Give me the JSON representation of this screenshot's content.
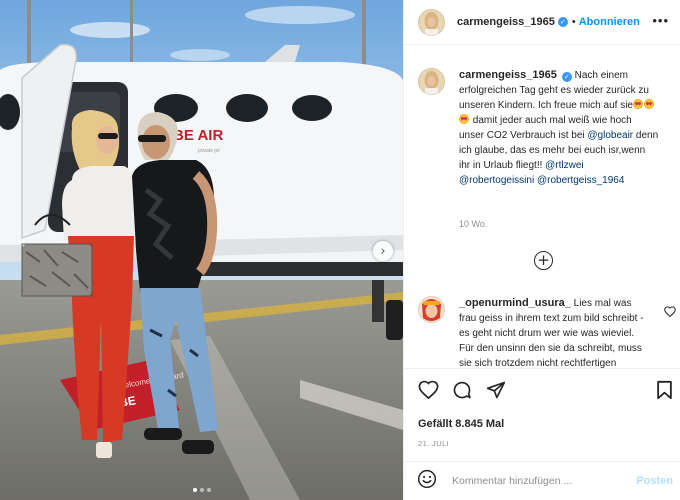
{
  "photo": {
    "alt": "Foto von carmengeiss_1965",
    "plane_brand": "BE AIR",
    "plane_tagline": "private jet",
    "carpet_text": "Welcome on board",
    "carpet_brand": "BE",
    "carousel": {
      "dots": 3,
      "active": 1
    },
    "next_symbol": "›"
  },
  "header": {
    "username": "carmengeiss_1965",
    "verified_symbol": "✓",
    "separator": "•",
    "follow_label": "Abonnieren",
    "more_symbol": "•••"
  },
  "caption": {
    "username": "carmengeiss_1965",
    "text_1": "Nach einem erfolgreichen Tag geht es wieder zurück zu unseren Kindern. Ich freue mich auf sie",
    "text_2": "damit jeder auch mal weiß wie hoch unser CO2 Verbrauch ist bei",
    "mention_globeair": "@globeair",
    "text_3": "denn ich glaube, das es mehr bei euch isr,wenn ihr in Urlaub fliegt!!",
    "mention_rtlzwei": "@rtlzwei",
    "mention_robertogeissini": "@robertogeissini",
    "mention_robertgeiss": "@robertgeiss_1964",
    "time": "10 Wo."
  },
  "load_more_symbol": "+",
  "comment": {
    "username": "_openurmind_usura_",
    "text": "Lies mal was frau geiss in ihrem text zum bild schreibt - es geht nicht drum wer wie was wieviel. Für den unsinn den sie da schreibt, muss sie sich trotzdem nicht rechtfertigen"
  },
  "likes_text": "Gefällt 8.845 Mal",
  "date_text": "21. JULI",
  "add_comment": {
    "placeholder": "Kommentar hinzufügen ...",
    "post_label": "Posten"
  },
  "colors": {
    "link": "#00376b",
    "follow": "#0095f6",
    "verified": "#3897f0",
    "muted": "#8e8e8e",
    "trousers": "#d63a24"
  }
}
